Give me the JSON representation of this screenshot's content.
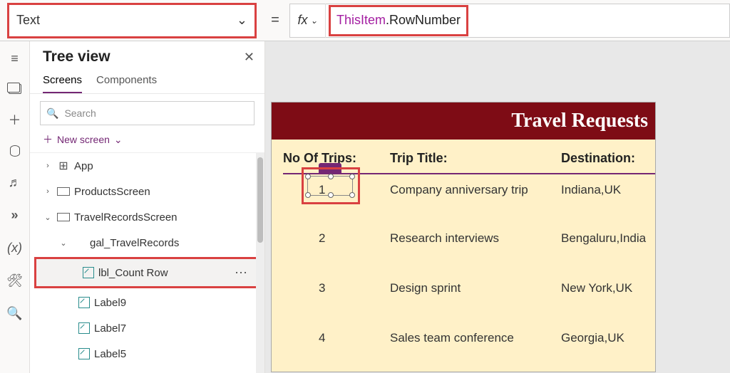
{
  "property_selector": {
    "value": "Text"
  },
  "formula": {
    "equals": "=",
    "fx_label": "fx",
    "this_item": "ThisItem",
    "rest": ".RowNumber"
  },
  "tree": {
    "title": "Tree view",
    "close": "✕",
    "tabs": {
      "screens": "Screens",
      "components": "Components"
    },
    "search_placeholder": "Search",
    "new_screen": "New screen",
    "items": {
      "app": "App",
      "products": "ProductsScreen",
      "travel": "TravelRecordsScreen",
      "gallery": "gal_TravelRecords",
      "lbl_count": "lbl_Count Row",
      "label9": "Label9",
      "label7": "Label7",
      "label5": "Label5"
    },
    "more": "⋯"
  },
  "app": {
    "title": "Travel Requests",
    "columns": {
      "c1": "No Of Trips:",
      "c2": "Trip Title:",
      "c3": "Destination:"
    },
    "rows": [
      {
        "no": "1",
        "title": "Company anniversary trip",
        "dest": "Indiana,UK"
      },
      {
        "no": "2",
        "title": "Research interviews",
        "dest": "Bengaluru,India"
      },
      {
        "no": "3",
        "title": "Design sprint",
        "dest": "New York,UK"
      },
      {
        "no": "4",
        "title": "Sales team conference",
        "dest": "Georgia,UK"
      }
    ]
  }
}
